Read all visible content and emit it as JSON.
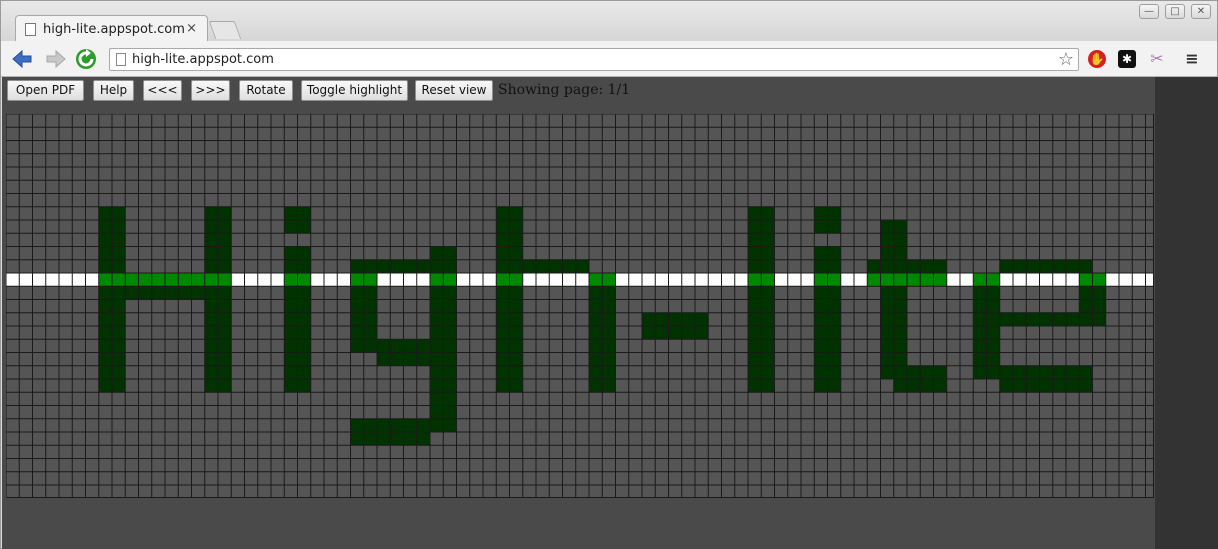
{
  "browser": {
    "tab_title": "high-lite.appspot.com",
    "tab_close": "×",
    "url": "high-lite.appspot.com",
    "window_controls": {
      "minimize": "—",
      "maximize": "□",
      "close": "✕"
    }
  },
  "app": {
    "buttons": {
      "open_pdf": "Open PDF",
      "help": "Help",
      "prev": "<<<",
      "next": ">>>",
      "rotate": "Rotate",
      "toggle_highlight": "Toggle highlight",
      "reset_view": "Reset view"
    },
    "status_text": "Showing page: 1/1"
  },
  "document": {
    "rendered_text": "High-lite",
    "highlight_row_color": "#ffffff",
    "ink_color": "#003300",
    "highlight_ink_color": "#008800",
    "grid_line_color": "#1a1a1a",
    "cell_background": "#555555"
  },
  "colors": {
    "content_background": "#4a4a4a",
    "right_panel": "#333333",
    "reload_green": "#2e9a2e",
    "back_blue": "#3a6fc4"
  }
}
